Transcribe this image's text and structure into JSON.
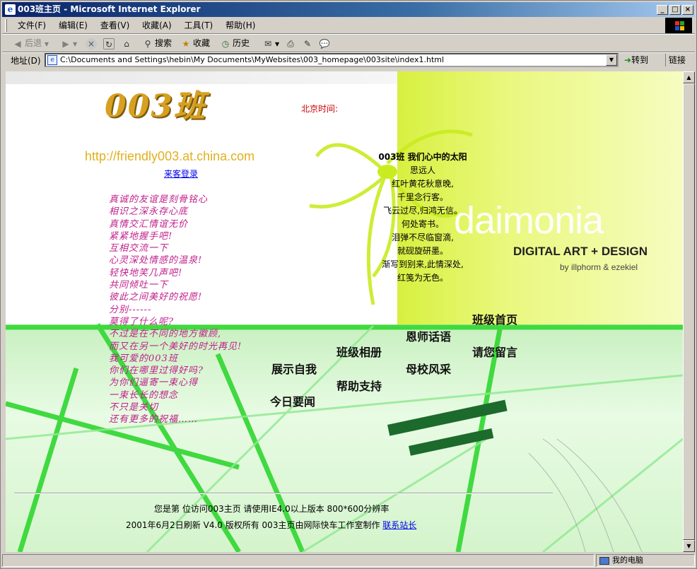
{
  "window": {
    "title": "003班主页 - Microsoft Internet Explorer",
    "controls": [
      "_",
      "□",
      "×"
    ]
  },
  "menu": [
    "文件(F)",
    "编辑(E)",
    "查看(V)",
    "收藏(A)",
    "工具(T)",
    "帮助(H)"
  ],
  "toolbar": {
    "back": "后退",
    "search": "搜索",
    "favorites": "收藏",
    "history": "历史"
  },
  "address": {
    "label": "地址(D)",
    "value": "C:\\Documents and Settings\\hebin\\My Documents\\MyWebsites\\003_homepage\\003site\\index1.html",
    "go": "转到",
    "links": "链接"
  },
  "page": {
    "logo": "003班",
    "url": "http://friendly003.at.china.com",
    "guest_login": "来客登录",
    "beijing_time": "北京时间:",
    "poem": {
      "title": "003班  我们心中的太阳",
      "author": "思远人",
      "lines": [
        "红叶黄花秋意晚,",
        "千里念行客。",
        "飞云过尽,归鸿无信。",
        "何处寄书。",
        "泪弹不尽临窗滴,",
        "就砚旋研墨。",
        "渐写到别来,此情深处,",
        "红笺为无色。"
      ]
    },
    "message_lines": [
      "真诚的友谊是刻骨铭心",
      "相识之深永存心底",
      "真情交汇情谊无价",
      "紧紧地握手吧!",
      "互相交流一下",
      "心灵深处情感的温泉!",
      "轻快地笑几声吧!",
      "共同倾吐一下",
      "彼此之间美好的祝愿!",
      "分别------",
      "莫得了什么呢?",
      "不过是在不同的地方徽顾,",
      "而又在另一个美好的时光再见!",
      "我可爱的003班",
      "你们在哪里过得好吗?",
      "为你们逼寄一束心得",
      "一束长长的想念",
      "不只是关切",
      "还有更多的祝福……"
    ],
    "brand": {
      "name": "daimonia",
      "tagline": "DIGITAL ART + DESIGN",
      "credits": "by illphorm & ezekiel"
    },
    "nav": {
      "home": "班级首页",
      "teacher": "恩师话语",
      "album": "班级相册",
      "guestbook": "请您留言",
      "show": "展示自我",
      "school": "母校风采",
      "help": "帮助支持",
      "news": "今日要闻"
    },
    "footer": {
      "line1": "您是第  位访问003主页 请使用IE4.0以上版本  800*600分辨率",
      "line2": "2001年6月2日刷新 V4.0 版权所有 003主页由网际快车工作室制作",
      "contact": "联系站长"
    }
  },
  "status": {
    "zone": "我的电脑"
  },
  "colors": {
    "title_gradient_start": "#0a246a",
    "link": "#0000ee",
    "message": "#c0208c",
    "time": "#cc0000",
    "lime": "#d8f040",
    "url": "#e0b020"
  }
}
